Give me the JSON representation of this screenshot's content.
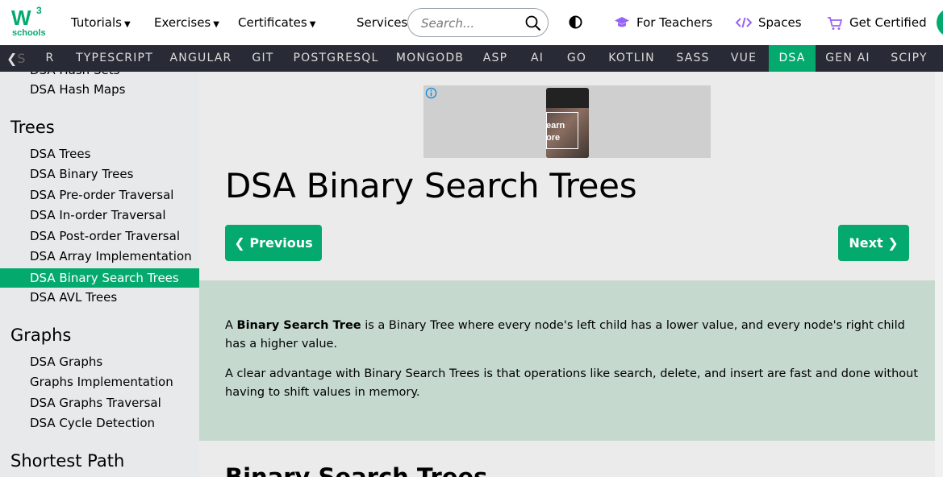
{
  "logo": {
    "mark": "W",
    "sup": "3",
    "subtext": "schools"
  },
  "topnav": {
    "tutorials": "Tutorials",
    "exercises": "Exercises",
    "certificates": "Certificates",
    "services": "Services",
    "search_placeholder": "Search...",
    "for_teachers": "For Teachers",
    "spaces": "Spaces",
    "get_certified": "Get Certified"
  },
  "subnav": {
    "items": [
      "R",
      "TYPESCRIPT",
      "ANGULAR",
      "GIT",
      "POSTGRESQL",
      "MONGODB",
      "ASP",
      "AI",
      "GO",
      "KOTLIN",
      "SASS",
      "VUE",
      "DSA",
      "GEN AI",
      "SCIPY"
    ],
    "active": "DSA"
  },
  "sidebar": {
    "partial_top": "DSA Hash Sets",
    "hash_maps": "DSA Hash Maps",
    "trees_heading": "Trees",
    "trees": [
      "DSA Trees",
      "DSA Binary Trees",
      "DSA Pre-order Traversal",
      "DSA In-order Traversal",
      "DSA Post-order Traversal",
      "DSA Array Implementation",
      "DSA Binary Search Trees",
      "DSA AVL Trees"
    ],
    "graphs_heading": "Graphs",
    "graphs": [
      "DSA Graphs",
      "Graphs Implementation",
      "DSA Graphs Traversal",
      "DSA Cycle Detection"
    ],
    "shortest_heading": "Shortest Path"
  },
  "ad": {
    "text_line1": "earn",
    "text_line2": "ore"
  },
  "main": {
    "title": "DSA Binary Search Trees",
    "prev_label": "Previous",
    "next_label": "Next",
    "intro_a": "A ",
    "intro_bold": "Binary Search Tree",
    "intro_rest": " is a Binary Tree where every node's left child has a lower value, and every node's right child has a higher value.",
    "intro_p2": "A clear advantage with Binary Search Trees is that operations like search, delete, and insert are fast and done without having to shift values in memory.",
    "section_title": "Binary Search Trees"
  },
  "colors": {
    "accent": "#04aa6d",
    "subnav_bg": "#282a35",
    "sidebar_bg": "#e7e9eb",
    "intro_bg": "#c6d9cf"
  },
  "icons": {
    "search": "search-icon",
    "contrast": "contrast-icon",
    "teachers": "graduation-cap-icon",
    "spaces": "code-icon",
    "cart": "cart-icon",
    "info": "info-icon"
  }
}
